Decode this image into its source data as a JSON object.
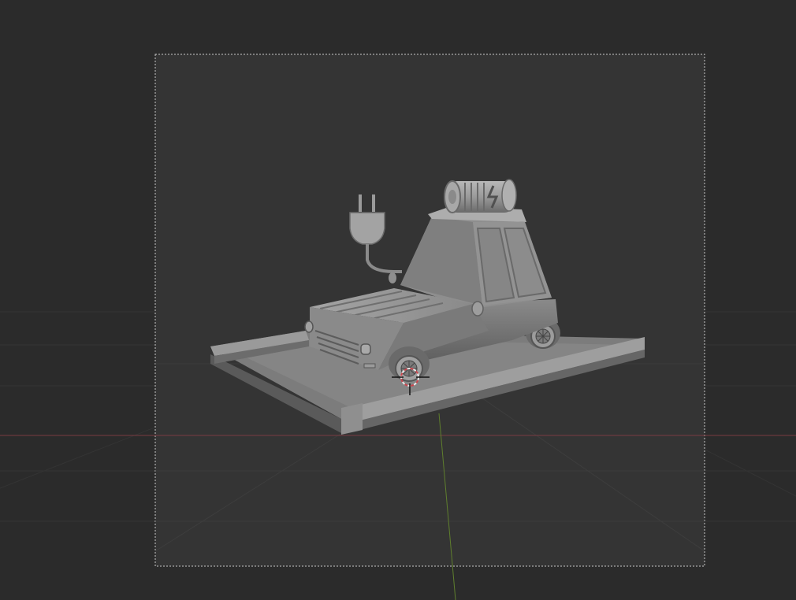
{
  "viewport": {
    "background_color": "#2b2b2b",
    "camera_frame_fill": "#343434",
    "camera_frame_border": "dashed",
    "grid_line_color": "#3a3a3a",
    "x_axis_color": "#7a3b42",
    "y_axis_color": "#5f7f2d"
  },
  "scene": {
    "model_color": "#8c8c8c",
    "objects": [
      "electric-car",
      "road-base",
      "plug",
      "battery",
      "wheels"
    ],
    "cursor_3d": {
      "color_a": "#c8464e",
      "color_b": "#e8e8e8"
    }
  }
}
